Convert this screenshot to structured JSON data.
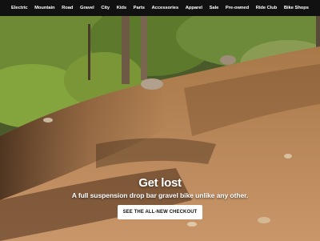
{
  "nav": {
    "items": [
      "Electric",
      "Mountain",
      "Road",
      "Gravel",
      "City",
      "Kids",
      "Parts",
      "Accessories",
      "Apparel",
      "Sale",
      "Pre-owned",
      "Ride Club",
      "Bike Shops"
    ]
  },
  "hero": {
    "headline": "Get lost",
    "subline": "A full suspension drop bar gravel bike unlike any other.",
    "cta_label": "SEE THE ALL-NEW CHECKOUT"
  },
  "colors": {
    "nav_bg": "#111111",
    "nav_text": "#ffffff",
    "cta_bg": "#ffffff",
    "cta_text": "#111111"
  }
}
